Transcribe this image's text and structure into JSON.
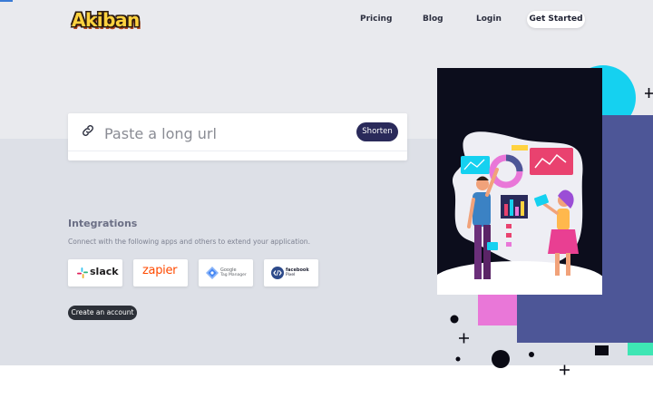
{
  "brand": {
    "logo_text": "Akiban"
  },
  "nav": {
    "items": [
      {
        "label": "Pricing"
      },
      {
        "label": "Blog"
      },
      {
        "label": "Login"
      }
    ],
    "cta_label": "Get Started"
  },
  "shortener": {
    "placeholder": "Paste a long url",
    "value": "",
    "button_label": "Shorten"
  },
  "integrations": {
    "title": "Integrations",
    "description": "Connect with the following apps and others to extend your application.",
    "items": [
      {
        "name": "slack",
        "icon": "slack-logo"
      },
      {
        "name": "zapier",
        "icon": "zapier-logo"
      },
      {
        "name": "Google",
        "subtitle": "Tag Manager",
        "icon": "google-tag-manager-logo"
      },
      {
        "name": "facebook",
        "subtitle": "Pixel",
        "icon": "facebook-pixel-logo"
      }
    ]
  },
  "cta": {
    "create_account_label": "Create an account"
  },
  "colors": {
    "accent": "#2a2a5a",
    "brand_yellow": "#ffd23f",
    "hero_bg": "#0c0d1c",
    "panel_blue": "#4d5697",
    "cyan": "#15d1f0",
    "pink": "#e977d8"
  },
  "icons": {
    "url": "link-icon",
    "hero": "hero-illustration"
  }
}
